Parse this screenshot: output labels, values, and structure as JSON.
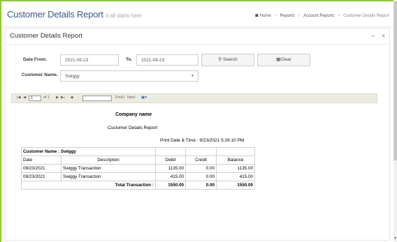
{
  "header": {
    "title": "Customer Details Report",
    "subtitle": "it all starts here",
    "breadcrumb": [
      "Home",
      "Reports",
      "Account Reports",
      "Customer Details Report"
    ]
  },
  "panel": {
    "title": "Customer Details Report",
    "minimize": "−",
    "close": "×"
  },
  "form": {
    "date_from_label": "Date From.",
    "date_from_value": "2021-09-23",
    "to_label": "To.",
    "to_value": "2021-09-23",
    "search_label": "Search",
    "clear_label": "Clear",
    "customer_label": "Customer Name.",
    "customer_value": "Swiggy"
  },
  "toolbar": {
    "page_value": "1",
    "of_label": "of 1",
    "find_label": "Find",
    "next_label": "Next",
    "sep": "|"
  },
  "report": {
    "company": "Company name",
    "title": "Customer Details Report",
    "print_date": "Print Date & Time : 9/23/2021 5:26:10 PM",
    "customer_header": "Customer Name : Swiggy",
    "columns": [
      "Date",
      "Description",
      "Debit",
      "Credit",
      "Balance"
    ],
    "rows": [
      [
        "09/23/2021",
        "Swiggy Transaction",
        "1135.00",
        "0.00",
        "1135.00"
      ],
      [
        "09/23/2021",
        "Swiggy Transaction",
        "415.00",
        "0.00",
        "415.00"
      ]
    ],
    "total_label": "Total Transaction :",
    "total_debit": "1550.00",
    "total_credit": "0.00",
    "total_balance": "1550.00"
  },
  "colors": {
    "accent_green": "#8cc63f",
    "title_blue": "#3c5a87",
    "toolbar_bg": "#ecebe0"
  }
}
